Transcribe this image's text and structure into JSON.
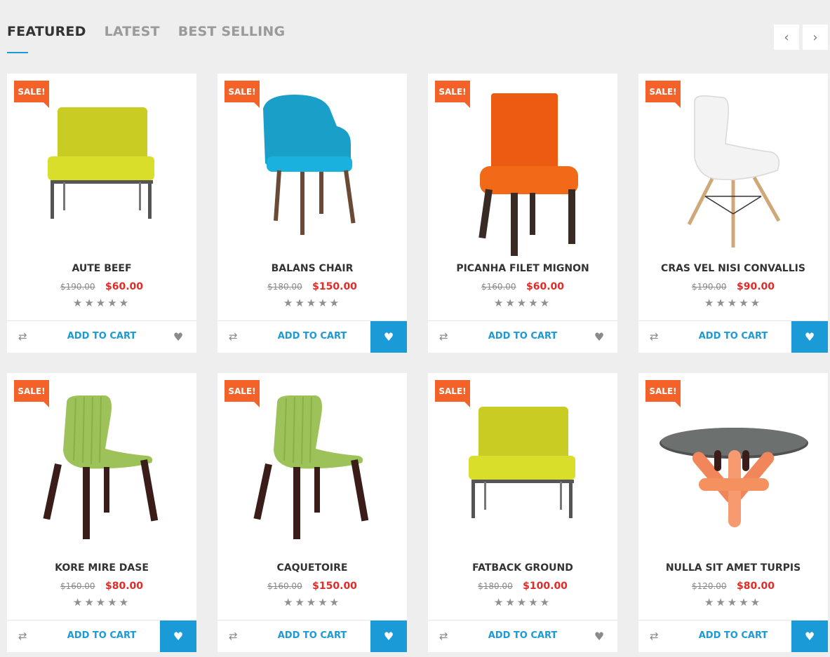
{
  "tabs": [
    {
      "label": "FEATURED",
      "active": true
    },
    {
      "label": "LATEST",
      "active": false
    },
    {
      "label": "BEST SELLING",
      "active": false
    }
  ],
  "nav": {
    "prev_icon": "‹",
    "next_icon": "›"
  },
  "badge_label": "SALE!",
  "add_to_cart_label": "ADD TO CART",
  "rating_glyph": "★★★★★",
  "products": [
    {
      "name": "AUTE BEEF",
      "old_price": "$190.00",
      "price": "$60.00",
      "image": "lounge-yellow",
      "wishlisted": false
    },
    {
      "name": "BALANS CHAIR",
      "old_price": "$180.00",
      "price": "$150.00",
      "image": "armchair-blue",
      "wishlisted": true
    },
    {
      "name": "PICANHA FILET MIGNON",
      "old_price": "$160.00",
      "price": "$60.00",
      "image": "dining-orange",
      "wishlisted": false
    },
    {
      "name": "CRAS VEL NISI CONVALLIS",
      "old_price": "$190.00",
      "price": "$90.00",
      "image": "eames-white",
      "wishlisted": true
    },
    {
      "name": "KORE MIRE DASE",
      "old_price": "$160.00",
      "price": "$80.00",
      "image": "chair-green",
      "wishlisted": true
    },
    {
      "name": "CAQUETOIRE",
      "old_price": "$160.00",
      "price": "$150.00",
      "image": "chair-green",
      "wishlisted": true
    },
    {
      "name": "FATBACK GROUND",
      "old_price": "$180.00",
      "price": "$100.00",
      "image": "lounge-yellow",
      "wishlisted": false
    },
    {
      "name": "NULLA SIT AMET TURPIS",
      "old_price": "$120.00",
      "price": "$80.00",
      "image": "table-glass",
      "wishlisted": true
    }
  ],
  "colors": {
    "accent": "#1a9ad6",
    "sale": "#f4622a",
    "price": "#e02b27"
  }
}
